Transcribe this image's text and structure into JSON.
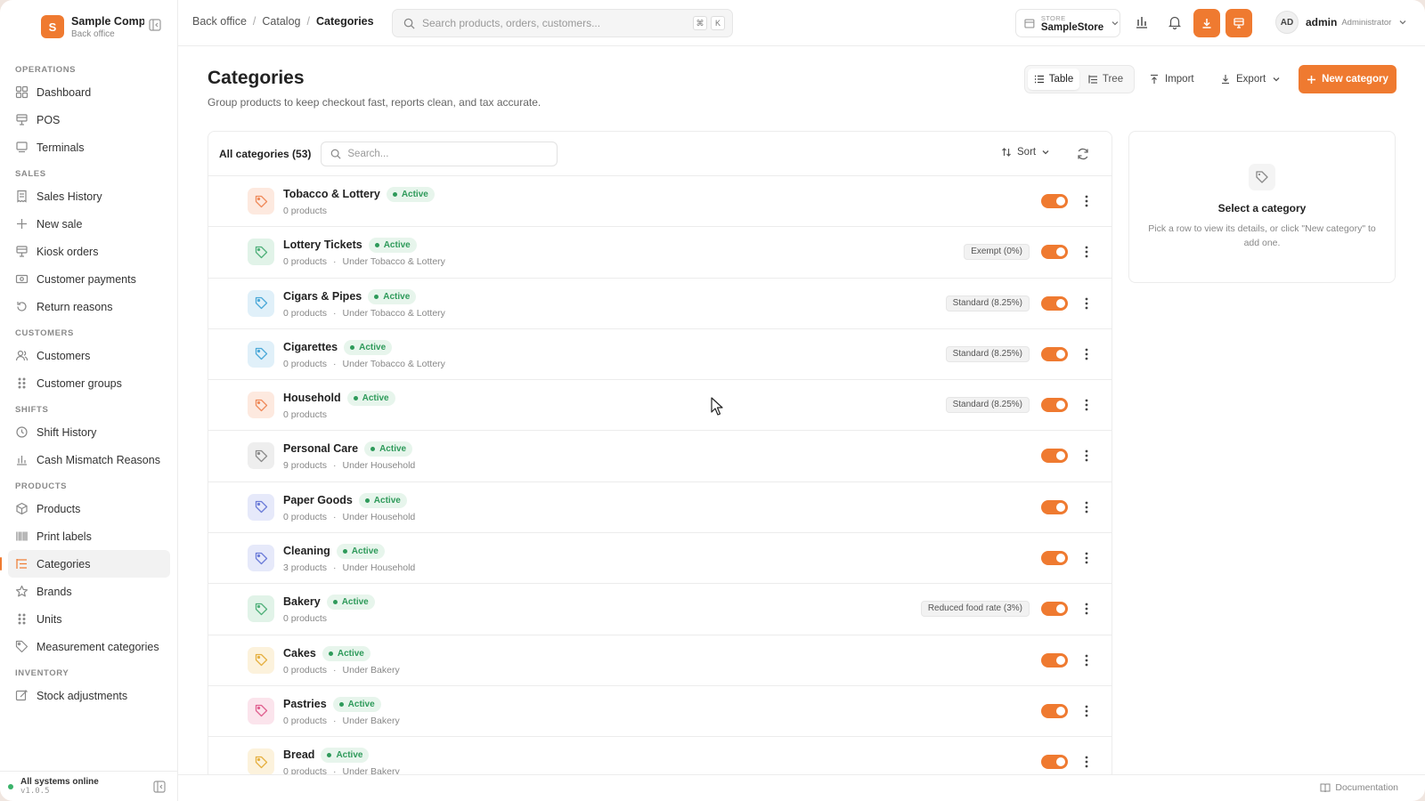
{
  "brand": {
    "logo_letter": "S",
    "name": "Sample Compa",
    "sub": "Back office"
  },
  "colors": {
    "accent": "#ef7a30",
    "active_green": "#2e9a5a"
  },
  "sidebar": {
    "sections": [
      {
        "title": "OPERATIONS",
        "items": [
          {
            "label": "Dashboard",
            "icon": "dashboard-icon"
          },
          {
            "label": "POS",
            "icon": "pos-icon"
          },
          {
            "label": "Terminals",
            "icon": "terminal-icon"
          }
        ]
      },
      {
        "title": "SALES",
        "items": [
          {
            "label": "Sales History",
            "icon": "receipt-icon"
          },
          {
            "label": "New sale",
            "icon": "plus-icon"
          },
          {
            "label": "Kiosk orders",
            "icon": "kiosk-icon"
          },
          {
            "label": "Customer payments",
            "icon": "payment-icon"
          },
          {
            "label": "Return reasons",
            "icon": "return-icon"
          }
        ]
      },
      {
        "title": "CUSTOMERS",
        "items": [
          {
            "label": "Customers",
            "icon": "users-icon"
          },
          {
            "label": "Customer groups",
            "icon": "grid-dots-icon"
          }
        ]
      },
      {
        "title": "SHIFTS",
        "items": [
          {
            "label": "Shift History",
            "icon": "clock-icon"
          },
          {
            "label": "Cash Mismatch Reasons",
            "icon": "bar-chart-icon"
          }
        ]
      },
      {
        "title": "PRODUCTS",
        "items": [
          {
            "label": "Products",
            "icon": "box-icon"
          },
          {
            "label": "Print labels",
            "icon": "barcode-icon"
          },
          {
            "label": "Categories",
            "icon": "list-tree-icon",
            "active": true
          },
          {
            "label": "Brands",
            "icon": "star-icon"
          },
          {
            "label": "Units",
            "icon": "grid-dots-icon"
          },
          {
            "label": "Measurement categories",
            "icon": "tag-icon"
          }
        ]
      },
      {
        "title": "INVENTORY",
        "items": [
          {
            "label": "Stock adjustments",
            "icon": "edit-icon"
          }
        ]
      }
    ],
    "footer": {
      "status": "All systems online",
      "version": "v1.0.5"
    }
  },
  "topbar": {
    "breadcrumb": [
      "Back office",
      "Catalog",
      "Categories"
    ],
    "search_placeholder": "Search products, orders, customers...",
    "shortcut": [
      "⌘",
      "K"
    ],
    "store_label": "STORE",
    "store_name": "SampleStore",
    "user_initials": "AD",
    "user_name": "admin",
    "user_role": "Administrator"
  },
  "page": {
    "title": "Categories",
    "subtitle": "Group products to keep checkout fast, reports clean, and tax accurate.",
    "view_table": "Table",
    "view_tree": "Tree",
    "import_label": "Import",
    "export_label": "Export",
    "new_label": "New category"
  },
  "list": {
    "count_label": "All categories (53)",
    "search_placeholder": "Search...",
    "sort_label": "Sort",
    "rows": [
      {
        "name": "Tobacco & Lottery",
        "status": "Active",
        "products": "0 products",
        "parent": "",
        "tax": "",
        "color": "#ef8a5a",
        "bg": "#fde9df"
      },
      {
        "name": "Lottery Tickets",
        "status": "Active",
        "products": "0 products",
        "parent": "Under Tobacco & Lottery",
        "tax": "Exempt (0%)",
        "color": "#4fb07a",
        "bg": "#e1f3e8"
      },
      {
        "name": "Cigars & Pipes",
        "status": "Active",
        "products": "0 products",
        "parent": "Under Tobacco & Lottery",
        "tax": "Standard (8.25%)",
        "color": "#4aa8d8",
        "bg": "#e0f0f9"
      },
      {
        "name": "Cigarettes",
        "status": "Active",
        "products": "0 products",
        "parent": "Under Tobacco & Lottery",
        "tax": "Standard (8.25%)",
        "color": "#4aa8d8",
        "bg": "#e0f0f9"
      },
      {
        "name": "Household",
        "status": "Active",
        "products": "0 products",
        "parent": "",
        "tax": "Standard (8.25%)",
        "color": "#ef8a5a",
        "bg": "#fde9df"
      },
      {
        "name": "Personal Care",
        "status": "Active",
        "products": "9 products",
        "parent": "Under Household",
        "tax": "",
        "color": "#8a8a8a",
        "bg": "#eeeeee"
      },
      {
        "name": "Paper Goods",
        "status": "Active",
        "products": "0 products",
        "parent": "Under Household",
        "tax": "",
        "color": "#6b7bd8",
        "bg": "#e6e9fa"
      },
      {
        "name": "Cleaning",
        "status": "Active",
        "products": "3 products",
        "parent": "Under Household",
        "tax": "",
        "color": "#6b7bd8",
        "bg": "#e6e9fa"
      },
      {
        "name": "Bakery",
        "status": "Active",
        "products": "0 products",
        "parent": "",
        "tax": "Reduced food rate (3%)",
        "color": "#4fb07a",
        "bg": "#e1f3e8"
      },
      {
        "name": "Cakes",
        "status": "Active",
        "products": "0 products",
        "parent": "Under Bakery",
        "tax": "",
        "color": "#e5b040",
        "bg": "#fcf2dc"
      },
      {
        "name": "Pastries",
        "status": "Active",
        "products": "0 products",
        "parent": "Under Bakery",
        "tax": "",
        "color": "#e06090",
        "bg": "#fbe4ec"
      },
      {
        "name": "Bread",
        "status": "Active",
        "products": "0 products",
        "parent": "Under Bakery",
        "tax": "",
        "color": "#e5b040",
        "bg": "#fcf2dc"
      }
    ]
  },
  "detail": {
    "title": "Select a category",
    "text": "Pick a row to view its details, or click \"New category\" to add one."
  },
  "bottombar": {
    "doc_label": "Documentation"
  }
}
